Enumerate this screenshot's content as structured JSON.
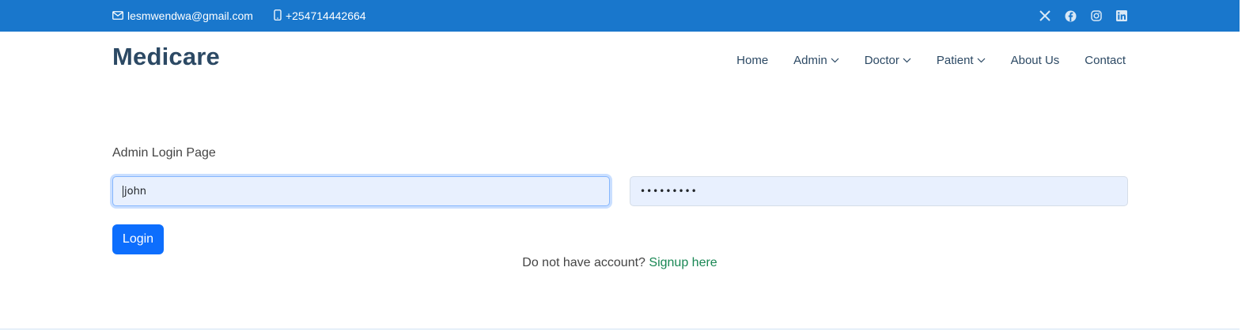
{
  "topbar": {
    "email": "lesmwendwa@gmail.com",
    "phone": "+254714442664",
    "icons": [
      "envelope-icon",
      "phone-icon",
      "x-twitter-icon",
      "facebook-icon",
      "instagram-icon",
      "linkedin-icon"
    ]
  },
  "header": {
    "logo": "Medicare",
    "nav": {
      "home": "Home",
      "admin": "Admin",
      "doctor": "Doctor",
      "patient": "Patient",
      "about": "About Us",
      "contact": "Contact"
    }
  },
  "form": {
    "title": "Admin Login Page",
    "username_value": "john",
    "password_value": "•••••••••",
    "login_label": "Login",
    "signup_prompt": "Do not have account?",
    "signup_link": "Signup here"
  },
  "colors": {
    "topbar_bg": "#1977cc",
    "logo": "#2c4964",
    "button": "#0d6efd",
    "link": "#198754",
    "input_bg": "#e8f0fe"
  }
}
